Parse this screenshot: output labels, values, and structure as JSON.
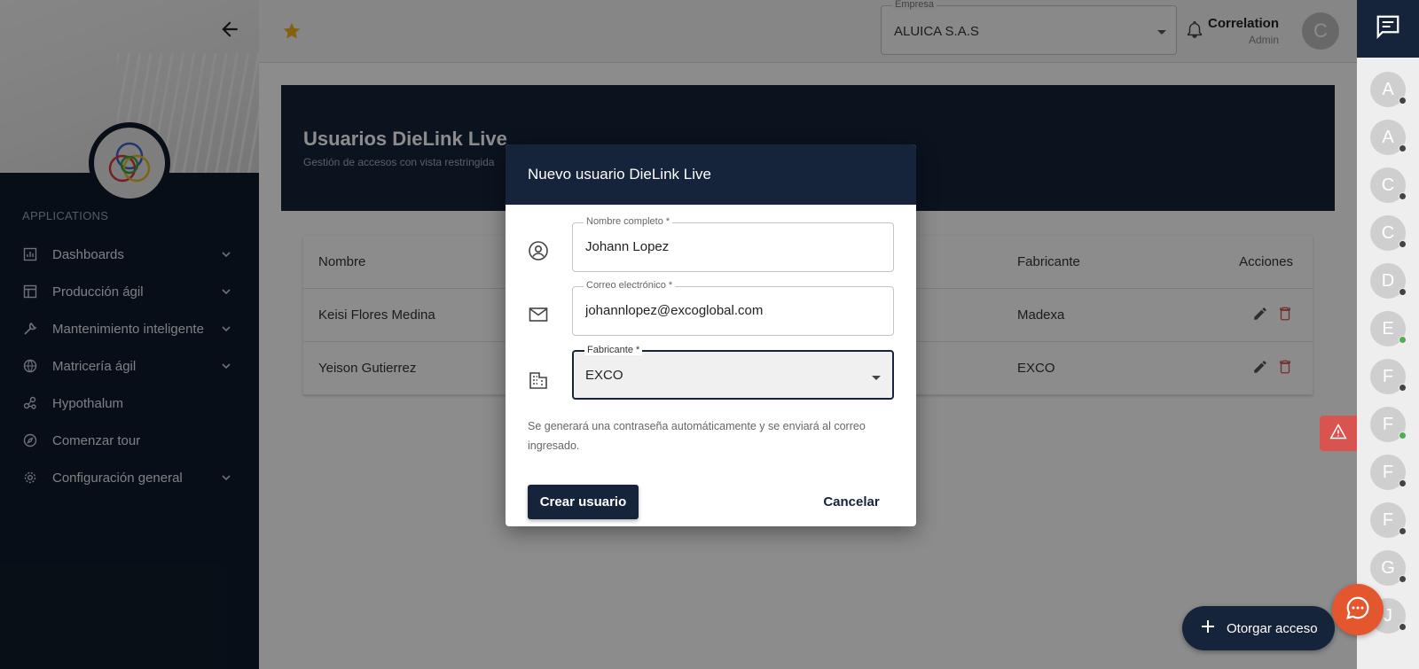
{
  "sidebar": {
    "section_label": "APPLICATIONS",
    "items": [
      {
        "label": "Dashboards",
        "icon": "dashboard-icon"
      },
      {
        "label": "Producción ágil",
        "icon": "layout-icon"
      },
      {
        "label": "Mantenimiento inteligente",
        "icon": "wrench-icon"
      },
      {
        "label": "Matricería ágil",
        "icon": "globe-icon"
      },
      {
        "label": "Hypothalum",
        "icon": "network-icon"
      },
      {
        "label": "Comenzar tour",
        "icon": "compass-icon"
      },
      {
        "label": "Configuración general",
        "icon": "gear-icon"
      }
    ]
  },
  "header": {
    "company_label": "Empresa",
    "company_value": "ALUICA S.A.S",
    "user_name": "Correlation",
    "user_role": "Admin",
    "user_initial": "C"
  },
  "page": {
    "title": "Usuarios DieLink Live",
    "subtitle": "Gestión de accesos con vista restringida"
  },
  "table": {
    "headers": {
      "name": "Nombre",
      "maker": "Fabricante",
      "actions": "Acciones"
    },
    "rows": [
      {
        "name": "Keisi Flores Medina",
        "maker": "Madexa"
      },
      {
        "name": "Yeison Gutierrez",
        "maker": "EXCO"
      }
    ]
  },
  "modal": {
    "title": "Nuevo usuario DieLink Live",
    "name_label": "Nombre completo *",
    "name_value": "Johann Lopez",
    "email_label": "Correo electrónico *",
    "email_value": "johannlopez@excoglobal.com",
    "maker_label": "Fabricante *",
    "maker_value": "EXCO",
    "hint": "Se generará una contraseña automáticamente y se enviará al correo ingresado.",
    "create_label": "Crear usuario",
    "cancel_label": "Cancelar"
  },
  "rightbar": {
    "avatars": [
      {
        "initial": "A",
        "online": false
      },
      {
        "initial": "A",
        "online": false
      },
      {
        "initial": "C",
        "online": false
      },
      {
        "initial": "C",
        "online": false
      },
      {
        "initial": "D",
        "online": false
      },
      {
        "initial": "E",
        "online": true
      },
      {
        "initial": "F",
        "online": false
      },
      {
        "initial": "F",
        "online": true
      },
      {
        "initial": "F",
        "online": false
      },
      {
        "initial": "F",
        "online": false
      },
      {
        "initial": "G",
        "online": false
      },
      {
        "initial": "J",
        "online": false
      }
    ]
  },
  "fab": {
    "label": "Otorgar acceso"
  },
  "colors": {
    "navy": "#15243a",
    "sidebar": "#0f1b2a",
    "danger": "#d9534f",
    "chat": "#e4572e",
    "star": "#f2b01e"
  }
}
